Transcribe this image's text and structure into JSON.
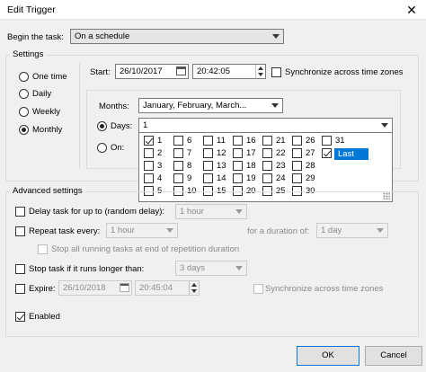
{
  "window": {
    "title": "Edit Trigger",
    "close_glyph": "✕"
  },
  "begin_task": {
    "label": "Begin the task:",
    "value": "On a schedule"
  },
  "settings": {
    "label": "Settings",
    "schedule_types": [
      "One time",
      "Daily",
      "Weekly",
      "Monthly"
    ],
    "selected": "Monthly",
    "start_label": "Start:",
    "start_date": "26/10/2017",
    "start_time": "20:42:05",
    "sync_label": "Synchronize across time zones",
    "months_label": "Months:",
    "months_value": "January, February, March...",
    "days_label": "Days:",
    "days_value": "1",
    "on_label": "On:",
    "day_columns": [
      [
        "1",
        "2",
        "3",
        "4",
        "5"
      ],
      [
        "6",
        "7",
        "8",
        "9",
        "10"
      ],
      [
        "11",
        "12",
        "13",
        "14",
        "15"
      ],
      [
        "16",
        "17",
        "18",
        "19",
        "20"
      ],
      [
        "21",
        "22",
        "23",
        "24",
        "25"
      ],
      [
        "26",
        "27",
        "28",
        "29",
        "30"
      ],
      [
        "31",
        "Last"
      ]
    ],
    "checked_days": [
      "1",
      "Last"
    ]
  },
  "advanced": {
    "label": "Advanced settings",
    "delay_label": "Delay task for up to (random delay):",
    "delay_value": "1 hour",
    "repeat_label": "Repeat task every:",
    "repeat_value": "1 hour",
    "duration_label": "for a duration of:",
    "duration_value": "1 day",
    "stop_running_label": "Stop all running tasks at end of repetition duration",
    "stop_longer_label": "Stop task if it runs longer than:",
    "stop_longer_value": "3 days",
    "expire_label": "Expire:",
    "expire_date": "26/10/2018",
    "expire_time": "20:45:04",
    "expire_sync_label": "Synchronize across time zones",
    "enabled_label": "Enabled"
  },
  "buttons": {
    "ok": "OK",
    "cancel": "Cancel"
  },
  "colors": {
    "accent": "#0078d7",
    "window_bg": "#f0f0f0"
  }
}
